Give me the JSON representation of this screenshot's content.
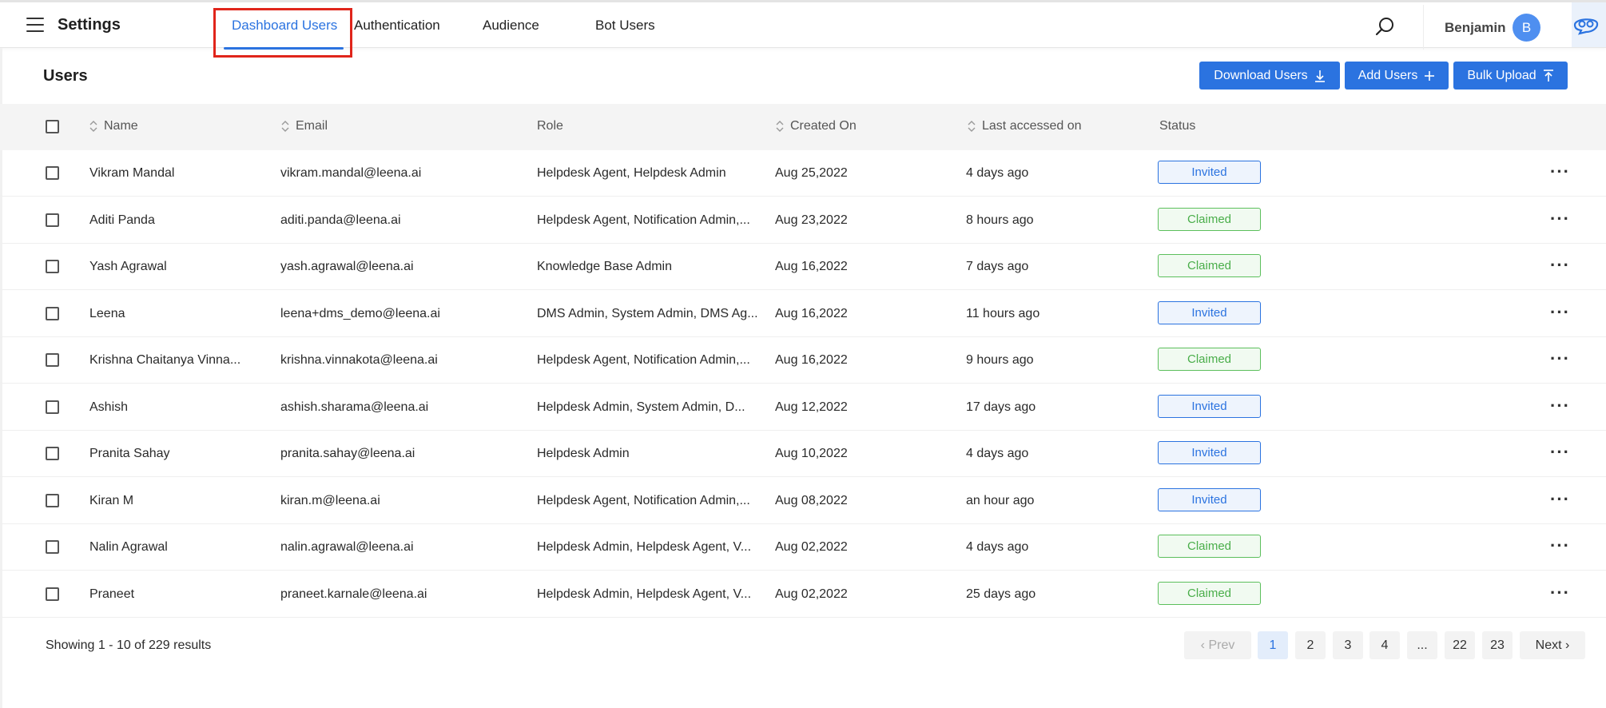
{
  "app": {
    "title": "Settings"
  },
  "tabs": [
    "Dashboard Users",
    "Authentication",
    "Audience",
    "Bot Users"
  ],
  "user": {
    "name": "Benjamin",
    "initial": "B"
  },
  "page": {
    "heading": "Users"
  },
  "actions": {
    "download": "Download Users",
    "add": "Add Users",
    "bulk": "Bulk Upload"
  },
  "columns": {
    "name": "Name",
    "email": "Email",
    "role": "Role",
    "created": "Created On",
    "accessed": "Last accessed on",
    "status": "Status"
  },
  "rows": [
    {
      "name": "Vikram Mandal",
      "email": "vikram.mandal@leena.ai",
      "role": "Helpdesk Agent, Helpdesk Admin",
      "created": "Aug 25,2022",
      "accessed": "4 days ago",
      "status": "Invited"
    },
    {
      "name": "Aditi Panda",
      "email": "aditi.panda@leena.ai",
      "role": "Helpdesk Agent, Notification Admin,...",
      "created": "Aug 23,2022",
      "accessed": "8 hours ago",
      "status": "Claimed"
    },
    {
      "name": "Yash Agrawal",
      "email": "yash.agrawal@leena.ai",
      "role": "Knowledge Base Admin",
      "created": "Aug 16,2022",
      "accessed": "7 days ago",
      "status": "Claimed"
    },
    {
      "name": "Leena",
      "email": "leena+dms_demo@leena.ai",
      "role": "DMS Admin, System Admin, DMS Ag...",
      "created": "Aug 16,2022",
      "accessed": "11 hours ago",
      "status": "Invited"
    },
    {
      "name": "Krishna Chaitanya Vinna...",
      "email": "krishna.vinnakota@leena.ai",
      "role": "Helpdesk Agent, Notification Admin,...",
      "created": "Aug 16,2022",
      "accessed": "9 hours ago",
      "status": "Claimed"
    },
    {
      "name": "Ashish",
      "email": "ashish.sharama@leena.ai",
      "role": "Helpdesk Admin, System Admin, D...",
      "created": "Aug 12,2022",
      "accessed": "17 days ago",
      "status": "Invited"
    },
    {
      "name": "Pranita Sahay",
      "email": "pranita.sahay@leena.ai",
      "role": "Helpdesk Admin",
      "created": "Aug 10,2022",
      "accessed": "4 days ago",
      "status": "Invited"
    },
    {
      "name": "Kiran M",
      "email": "kiran.m@leena.ai",
      "role": "Helpdesk Agent, Notification Admin,...",
      "created": "Aug 08,2022",
      "accessed": "an hour ago",
      "status": "Invited"
    },
    {
      "name": "Nalin Agrawal",
      "email": "nalin.agrawal@leena.ai",
      "role": "Helpdesk Admin, Helpdesk Agent, V...",
      "created": "Aug 02,2022",
      "accessed": "4 days ago",
      "status": "Claimed"
    },
    {
      "name": "Praneet",
      "email": "praneet.karnale@leena.ai",
      "role": "Helpdesk Admin, Helpdesk Agent, V...",
      "created": "Aug 02,2022",
      "accessed": "25 days ago",
      "status": "Claimed"
    }
  ],
  "footer": {
    "showing": "Showing  1 - 10 of  229 results"
  },
  "pagination": {
    "prev": "Prev",
    "pages": [
      "1",
      "2",
      "3",
      "4",
      "...",
      "22",
      "23"
    ],
    "next": "Next",
    "current": "1"
  },
  "icons": {
    "menu": "hamburger-icon",
    "search": "search-icon",
    "download": "download-icon",
    "add": "plus-icon",
    "upload": "upload-icon",
    "sort": "sort-icon",
    "more": "more-horizontal-icon",
    "brand": "brand-logo-icon"
  },
  "colors": {
    "accent": "#2b73e0",
    "invited": "#2b73e0",
    "claimed": "#4aae4a",
    "highlight": "#e0251b"
  }
}
